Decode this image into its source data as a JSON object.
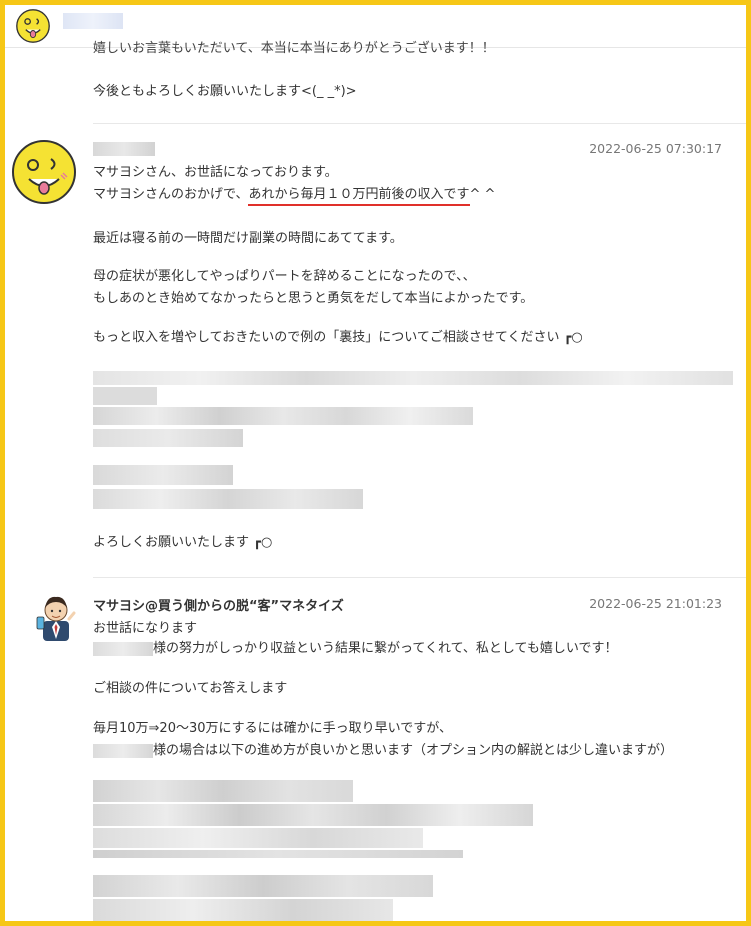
{
  "header": {
    "avatar_icon": "yellow-smiley-icon"
  },
  "messages": [
    {
      "id": "prev",
      "lines": [
        "嬉しいお言葉もいただいて、本当に本当にありがとうございます！！",
        "今後ともよろしくお願いいたします<(_ _*)>"
      ]
    },
    {
      "id": "customer",
      "avatar_icon": "yellow-smiley-icon",
      "timestamp": "2022-06-25 07:30:17",
      "lines": [
        "マサヨシさん、お世話になっております。",
        "マサヨシさんのおかげで、",
        "あれから毎月１０万円前後の収入です",
        "^ ^",
        "最近は寝る前の一時間だけ副業の時間にあててます。",
        "母の症状が悪化してやっぱりパートを辞めることになったので、、",
        "もしあのとき始めてなかったらと思うと勇気をだして本当によかったです。",
        "もっと収入を増やしておきたいので例の「裏技」についてご相談させてください ┏○",
        "よろしくお願いいたします ┏○"
      ]
    },
    {
      "id": "reply",
      "sender": "マサヨシ@買う側からの脱“客”マネタイズ",
      "avatar_icon": "businessman-avatar-icon",
      "timestamp": "2022-06-25 21:01:23",
      "lines": [
        "お世話になります",
        "様の努力がしっかり収益という結果に繋がってくれて、私としても嬉しいです！",
        "ご相談の件についてお答えします",
        "毎月10万⇒20～30万にするには確かに手っ取り早いですが、",
        "様の場合は以下の進め方が良いかと思います（オプション内の解説とは少し違いますが）"
      ]
    }
  ],
  "colors": {
    "frame": "#f6c716",
    "underline": "#e0302a",
    "avatar_yellow": "#f5e233"
  }
}
